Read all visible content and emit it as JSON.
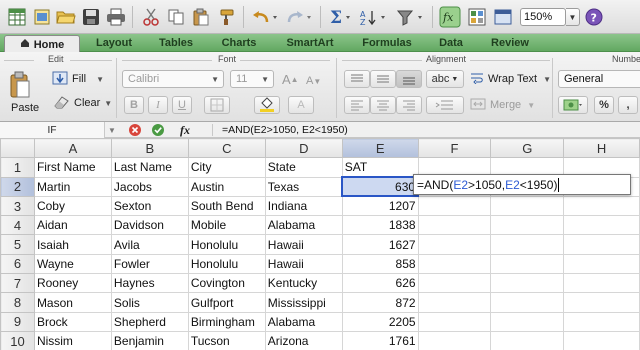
{
  "toolbar": {
    "zoom": "150%",
    "icons": [
      "grid-icon",
      "new-workbook-icon",
      "open-folder-icon",
      "save-icon",
      "print-icon",
      "cut-icon",
      "copy-icon",
      "paste-icon",
      "format-brush-icon",
      "undo-icon",
      "redo-icon",
      "autosum-icon",
      "sort-icon",
      "filter-icon",
      "fx-icon",
      "view-icon",
      "help-icon"
    ]
  },
  "ribbon_tabs": [
    "Home",
    "Layout",
    "Tables",
    "Charts",
    "SmartArt",
    "Formulas",
    "Data",
    "Review"
  ],
  "ribbon": {
    "groups": {
      "edit": "Edit",
      "font": "Font",
      "alignment": "Alignment",
      "number": "Numbe"
    },
    "paste_label": "Paste",
    "fill_label": "Fill",
    "clear_label": "Clear",
    "font_name": "Calibri",
    "font_size": "11",
    "wrap_text_label": "Wrap Text",
    "merge_label": "Merge",
    "number_format": "General",
    "abc_label": "abc",
    "bold": "B",
    "italic": "I",
    "underline": "U",
    "percent": "%",
    "comma": ","
  },
  "formula_bar": {
    "name_box": "IF",
    "fx": "fx",
    "formula": "=AND(E2>1050, E2<1950)"
  },
  "columns": [
    "A",
    "B",
    "C",
    "D",
    "E",
    "F",
    "G",
    "H"
  ],
  "rows": [
    {
      "n": "1",
      "cells": [
        "First Name",
        "Last Name",
        "City",
        "State",
        "SAT"
      ]
    },
    {
      "n": "2",
      "cells": [
        "Martin",
        "Jacobs",
        "Austin",
        "Texas",
        "630"
      ]
    },
    {
      "n": "3",
      "cells": [
        "Coby",
        "Sexton",
        "South Bend",
        "Indiana",
        "1207"
      ]
    },
    {
      "n": "4",
      "cells": [
        "Aidan",
        "Davidson",
        "Mobile",
        "Alabama",
        "1838"
      ]
    },
    {
      "n": "5",
      "cells": [
        "Isaiah",
        "Avila",
        "Honolulu",
        "Hawaii",
        "1627"
      ]
    },
    {
      "n": "6",
      "cells": [
        "Wayne",
        "Fowler",
        "Honolulu",
        "Hawaii",
        "858"
      ]
    },
    {
      "n": "7",
      "cells": [
        "Rooney",
        "Haynes",
        "Covington",
        "Kentucky",
        "626"
      ]
    },
    {
      "n": "8",
      "cells": [
        "Mason",
        "Solis",
        "Gulfport",
        "Mississippi",
        "872"
      ]
    },
    {
      "n": "9",
      "cells": [
        "Brock",
        "Shepherd",
        "Birmingham",
        "Alabama",
        "2205"
      ]
    },
    {
      "n": "10",
      "cells": [
        "Nissim",
        "Benjamin",
        "Tucson",
        "Arizona",
        "1761"
      ]
    }
  ],
  "editor": {
    "prefix": "=AND(",
    "ref1": "E2",
    "mid": ">1050, ",
    "ref2": "E2",
    "suffix": "<1950)"
  },
  "colors": {
    "ribbon_green": "#62a861",
    "selection_blue": "#2a56c6",
    "reference_blue": "#2d5bd4"
  }
}
